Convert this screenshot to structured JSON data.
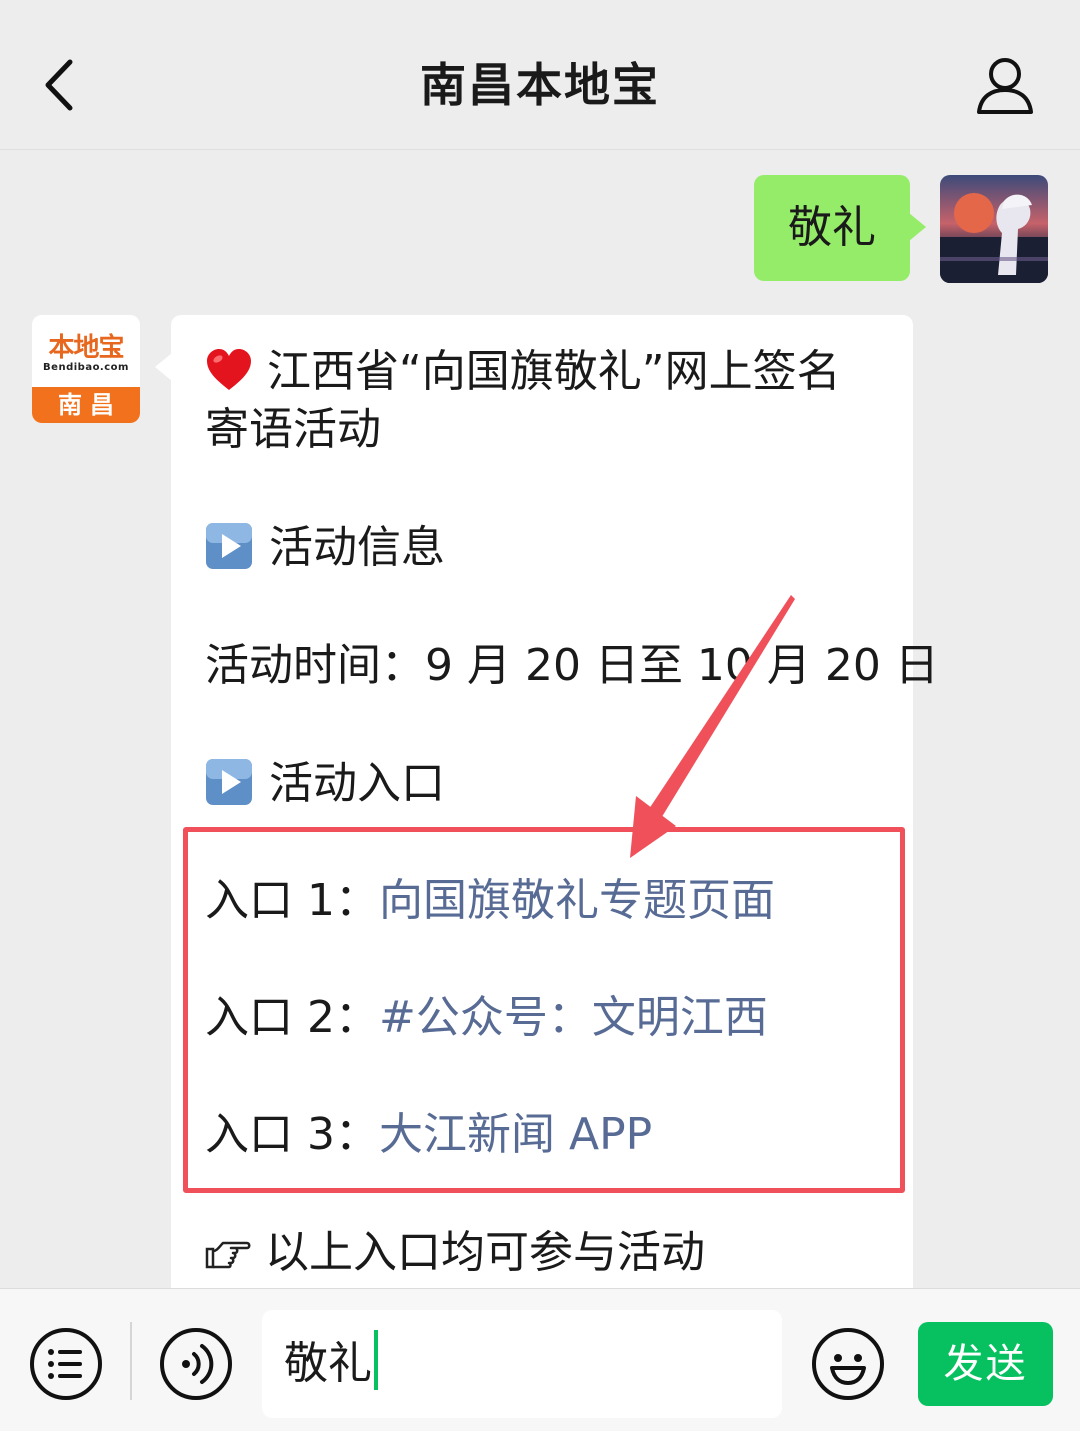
{
  "header": {
    "title": "南昌本地宝",
    "back_icon": "chevron-left-icon",
    "profile_icon": "person-icon"
  },
  "outgoing": {
    "text": "敬礼"
  },
  "account": {
    "logo_text": "本地宝",
    "logo_domain": "Bendibao.com",
    "logo_city": "南昌",
    "brand_color": "#f2711c"
  },
  "message": {
    "title_line1": "江西省“向国旗敬礼”网上签名",
    "title_line2": "寄语活动",
    "section_info": "活动信息",
    "time_label": "活动时间：9 月 20 日至 10 月 20 日",
    "section_entry": "活动入口",
    "entries": [
      {
        "label": "入口 1：",
        "link": "向国旗敬礼专题页面"
      },
      {
        "label": "入口 2：",
        "link": "#公众号：文明江西"
      },
      {
        "label": "入口 3：",
        "link": "大江新闻 APP"
      }
    ],
    "footer": "以上入口均可参与活动",
    "link_color": "#576b95"
  },
  "input_bar": {
    "value": "敬礼",
    "send_label": "发送",
    "menu_icon": "menu-list-icon",
    "voice_icon": "voice-icon",
    "emoji_icon": "emoji-icon",
    "send_color": "#07c160"
  },
  "annotation": {
    "box_color": "#f0505a"
  }
}
